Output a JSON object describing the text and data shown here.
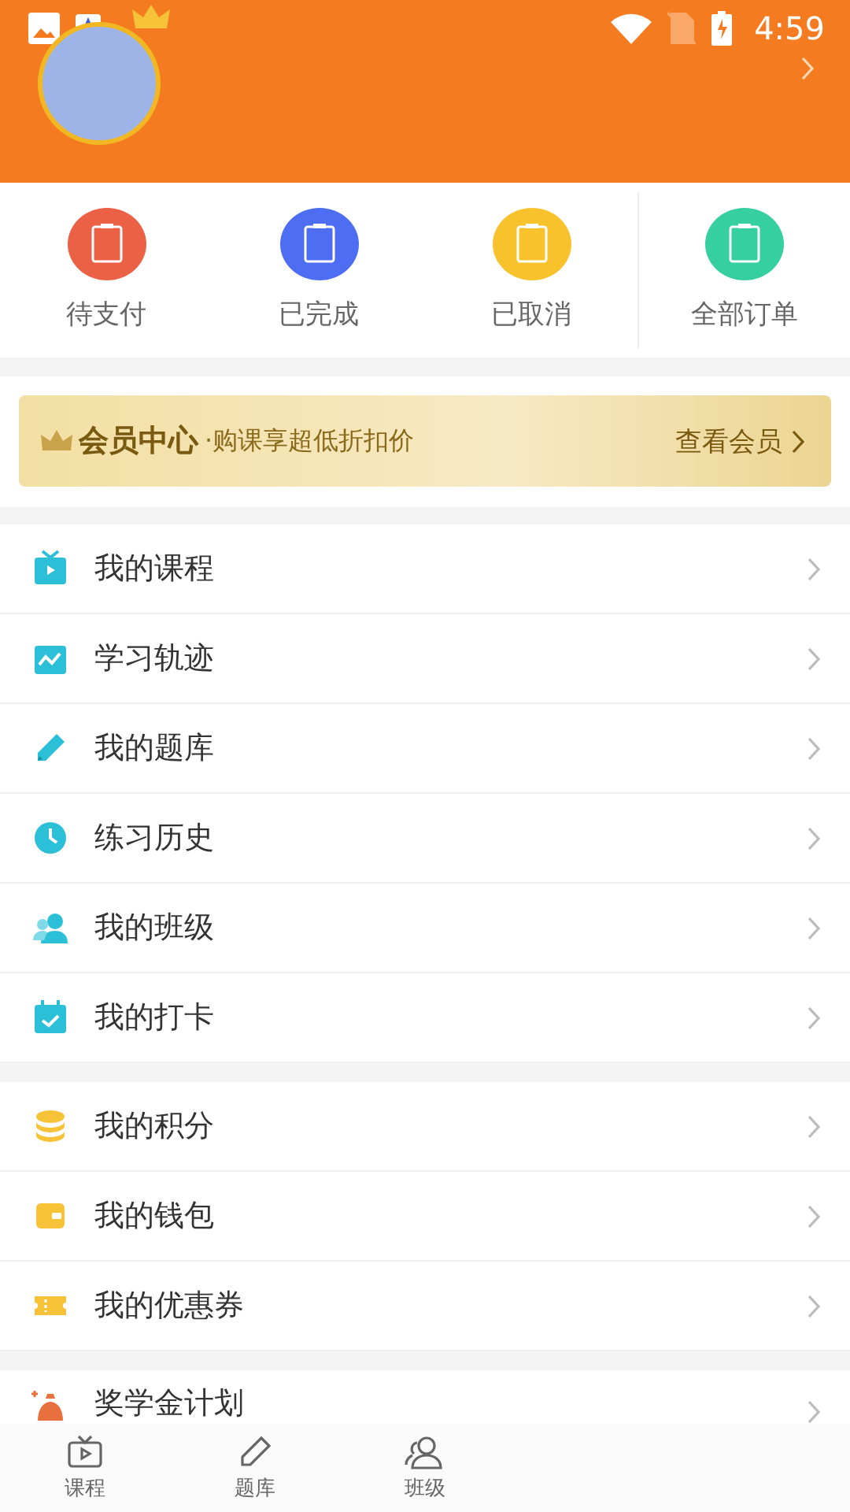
{
  "status_bar": {
    "time": "4:59"
  },
  "orders": [
    {
      "label": "待支付",
      "color": "#ea6146"
    },
    {
      "label": "已完成",
      "color": "#4d6ef2"
    },
    {
      "label": "已取消",
      "color": "#f7c22c"
    },
    {
      "label": "全部订单",
      "color": "#35cfa0"
    }
  ],
  "member_banner": {
    "title": "会员中心",
    "subtitle": "·购课享超低折扣价",
    "link": "查看会员"
  },
  "menu_groups": [
    [
      {
        "label": "我的课程"
      },
      {
        "label": "学习轨迹"
      },
      {
        "label": "我的题库"
      },
      {
        "label": "练习历史"
      },
      {
        "label": "我的班级"
      },
      {
        "label": "我的打卡"
      }
    ],
    [
      {
        "label": "我的积分"
      },
      {
        "label": "我的钱包"
      },
      {
        "label": "我的优惠券"
      }
    ],
    [
      {
        "label": "奖学金计划"
      }
    ]
  ],
  "bottom_nav": [
    {
      "label": "课程",
      "selected": false
    },
    {
      "label": "题库",
      "selected": false
    },
    {
      "label": "班级",
      "selected": false
    }
  ]
}
